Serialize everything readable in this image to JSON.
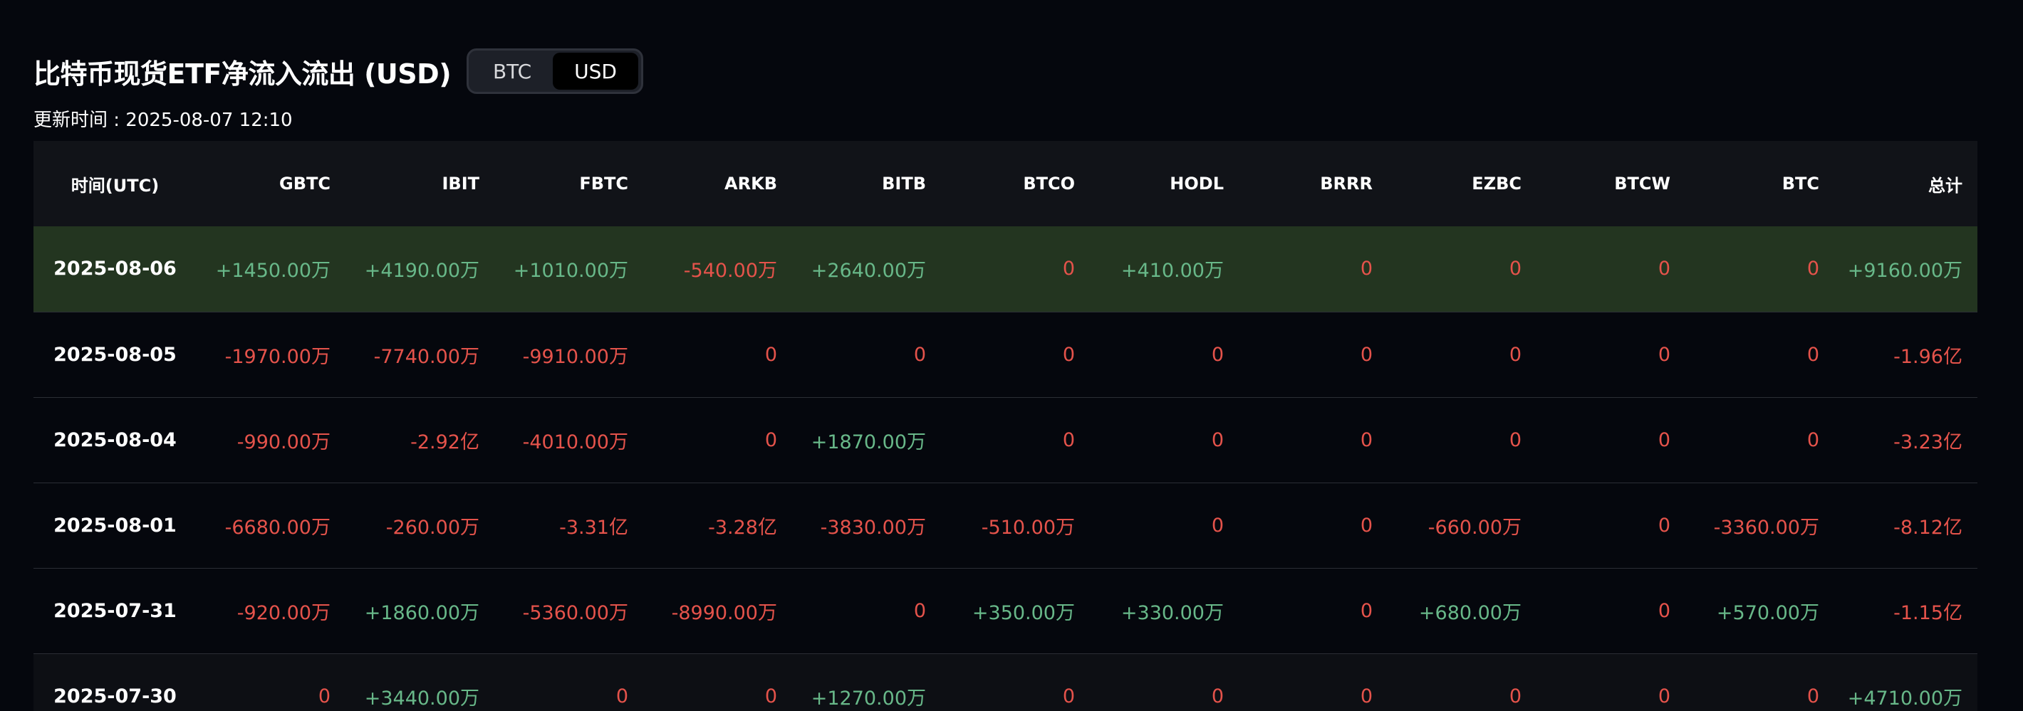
{
  "header": {
    "title": "比特币现货ETF净流入流出 (USD)",
    "toggle": [
      "BTC",
      "USD"
    ],
    "toggle_active": "USD",
    "updated": "更新时间 : 2025-08-07 12:10"
  },
  "colors": {
    "positive": "#68b889",
    "negative": "#e5534b",
    "highlight_row": "#233520"
  },
  "table": {
    "columns": [
      "时间(UTC)",
      "GBTC",
      "IBIT",
      "FBTC",
      "ARKB",
      "BITB",
      "BTCO",
      "HODL",
      "BRRR",
      "EZBC",
      "BTCW",
      "BTC",
      "总计"
    ],
    "rows": [
      [
        "2025-08-06",
        "+1450.00万",
        "+4190.00万",
        "+1010.00万",
        "-540.00万",
        "+2640.00万",
        "0",
        "+410.00万",
        "0",
        "0",
        "0",
        "0",
        "+9160.00万"
      ],
      [
        "2025-08-05",
        "-1970.00万",
        "-7740.00万",
        "-9910.00万",
        "0",
        "0",
        "0",
        "0",
        "0",
        "0",
        "0",
        "0",
        "-1.96亿"
      ],
      [
        "2025-08-04",
        "-990.00万",
        "-2.92亿",
        "-4010.00万",
        "0",
        "+1870.00万",
        "0",
        "0",
        "0",
        "0",
        "0",
        "0",
        "-3.23亿"
      ],
      [
        "2025-08-01",
        "-6680.00万",
        "-260.00万",
        "-3.31亿",
        "-3.28亿",
        "-3830.00万",
        "-510.00万",
        "0",
        "0",
        "-660.00万",
        "0",
        "-3360.00万",
        "-8.12亿"
      ],
      [
        "2025-07-31",
        "-920.00万",
        "+1860.00万",
        "-5360.00万",
        "-8990.00万",
        "0",
        "+350.00万",
        "+330.00万",
        "0",
        "+680.00万",
        "0",
        "+570.00万",
        "-1.15亿"
      ],
      [
        "2025-07-30",
        "0",
        "+3440.00万",
        "0",
        "0",
        "+1270.00万",
        "0",
        "0",
        "0",
        "0",
        "0",
        "0",
        "+4710.00万"
      ]
    ]
  }
}
